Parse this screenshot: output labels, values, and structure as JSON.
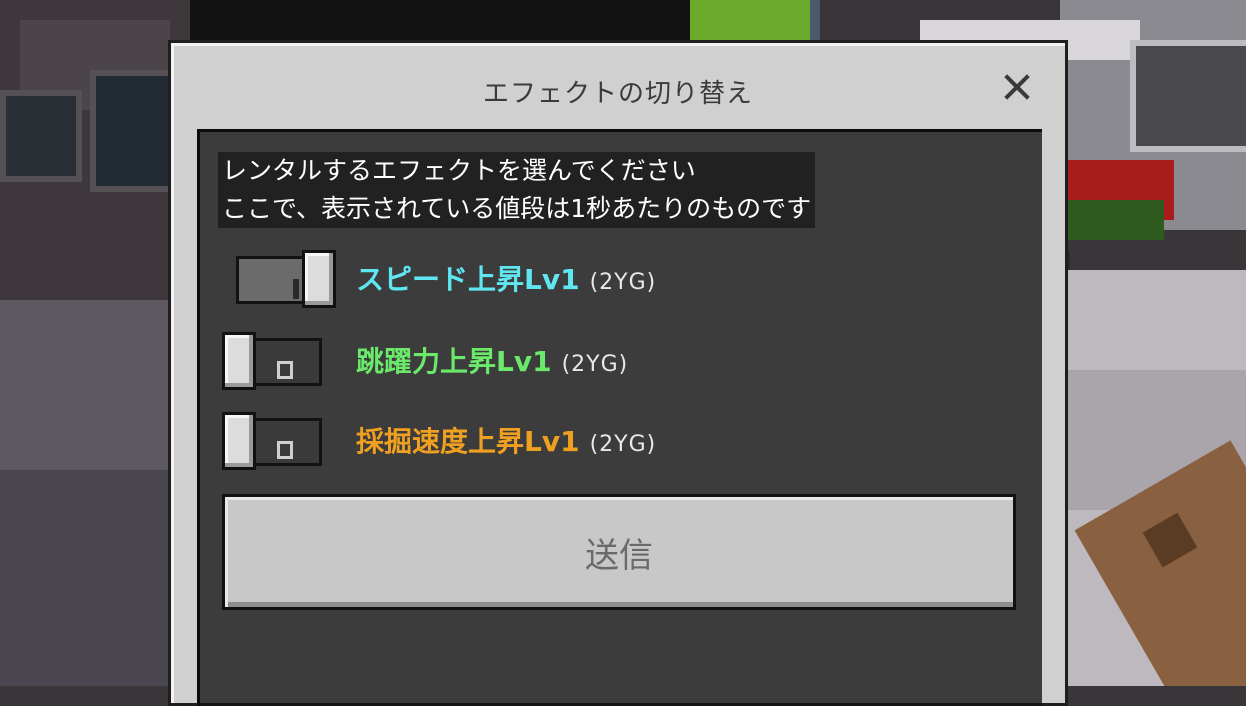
{
  "dialog": {
    "title": "エフェクトの切り替え",
    "close_icon": "close-icon",
    "description_line1": "レンタルするエフェクトを選んでください",
    "description_line2": "ここで、表示されている値段は1秒あたりのものです"
  },
  "effects": [
    {
      "name": "スピード上昇Lv1",
      "price": "(2YG)",
      "enabled": true,
      "color": "#5fe6f0"
    },
    {
      "name": "跳躍力上昇Lv1",
      "price": "(2YG)",
      "enabled": false,
      "color": "#6ae96a"
    },
    {
      "name": "採掘速度上昇Lv1",
      "price": "(2YG)",
      "enabled": false,
      "color": "#f0a020"
    }
  ],
  "submit_label": "送信",
  "colors": {
    "panel_bg": "#d0d0d0",
    "content_bg": "#121212"
  }
}
